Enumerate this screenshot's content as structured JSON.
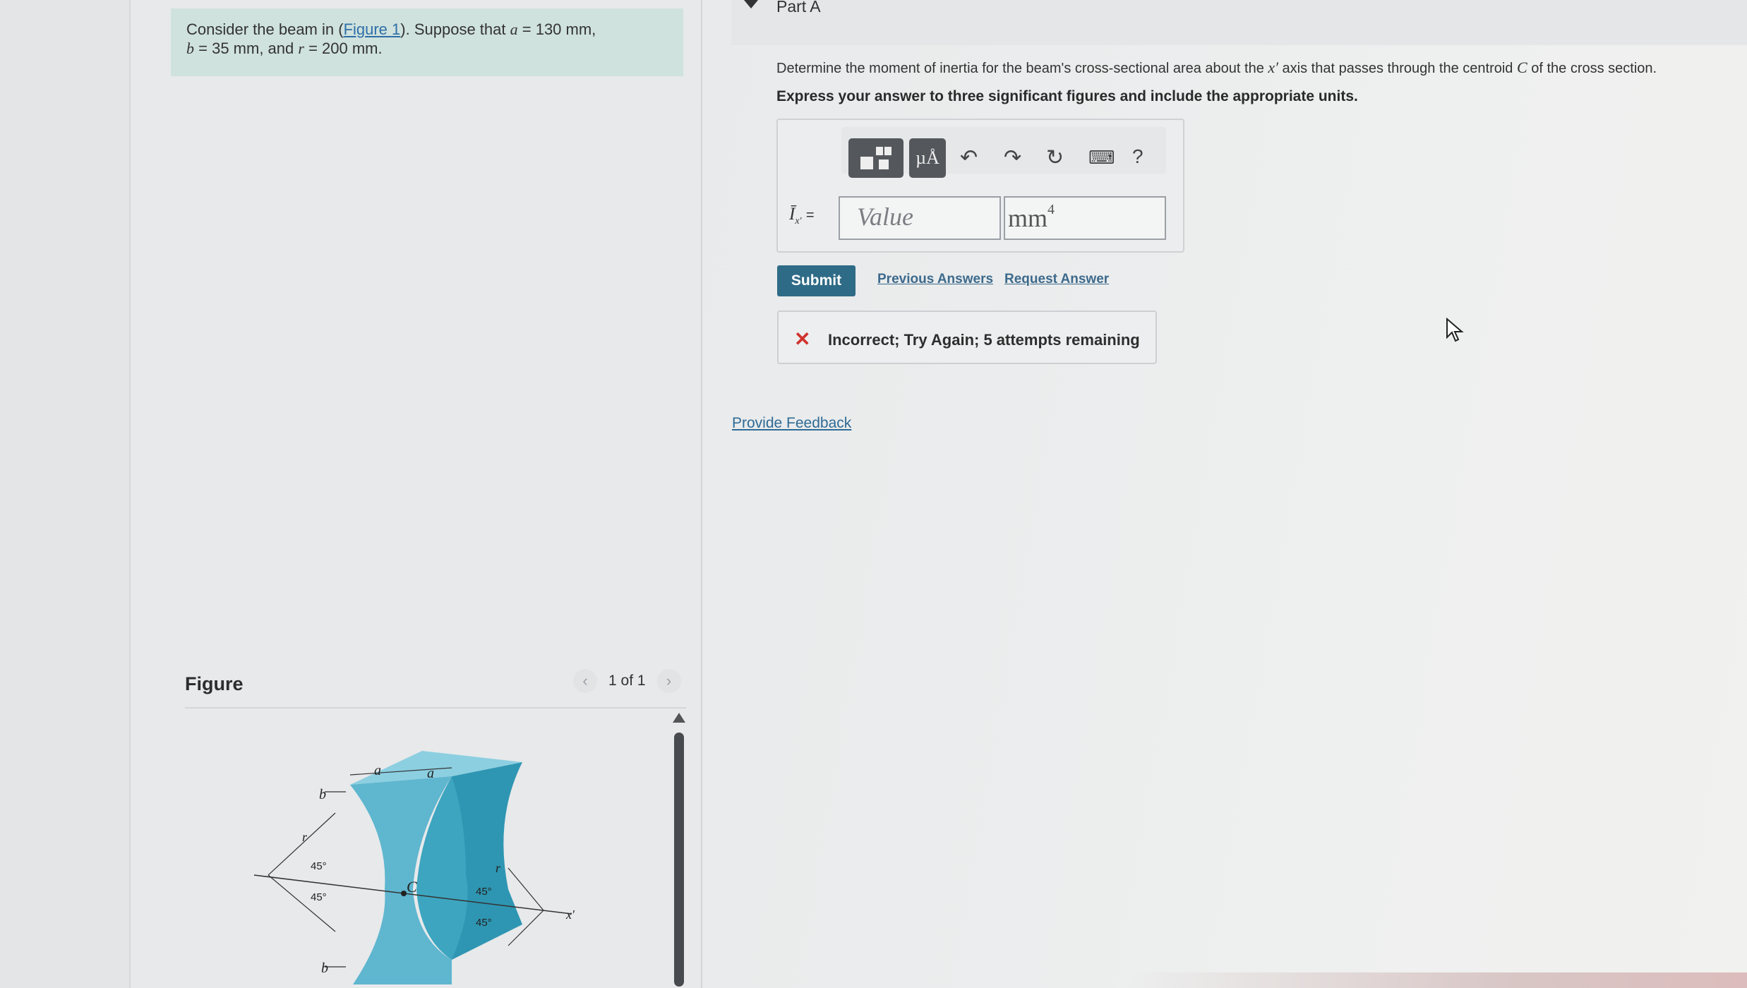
{
  "problem": {
    "prefix": "Consider the beam in (",
    "figure_link": "Figure 1",
    "suffix": "). Suppose that",
    "a_var": "a",
    "a_val": "= 130 mm,",
    "b_var": "b",
    "b_val": "= 35 mm, and",
    "r_var": "r",
    "r_val": "= 200 mm."
  },
  "figure": {
    "title": "Figure",
    "pager": "1 of 1",
    "prev_icon": "chevron-left",
    "next_icon": "chevron-right",
    "labels": {
      "a1": "a",
      "a2": "a",
      "b1": "b",
      "b2": "b",
      "r1": "r",
      "r2": "r",
      "c": "C",
      "x": "x′",
      "ang1": "45°",
      "ang2": "45°",
      "ang3": "45°",
      "ang4": "45°"
    },
    "colors": {
      "beam_front": "#5fb6cf",
      "beam_top": "#8ccfe1",
      "beam_side": "#2e96b2"
    }
  },
  "part": {
    "title": "Part A",
    "question_pre": "Determine the moment of inertia for the beam's cross-sectional area about the",
    "question_var": "x′",
    "question_mid": "axis that passes through the centroid",
    "question_c": "C",
    "question_post": "of the cross section.",
    "instruction": "Express your answer to three significant figures and include the appropriate units."
  },
  "answer": {
    "toolbar": [
      "templates-icon",
      "units-icon",
      "undo-icon",
      "redo-icon",
      "reset-icon",
      "keyboard-icon",
      "help-icon"
    ],
    "units_glyph": "µÅ",
    "help_glyph": "?",
    "label": "Ī",
    "label_sub": "x′",
    "label_eq": "=",
    "value_placeholder": "Value",
    "unit_base": "mm",
    "unit_exp": "4"
  },
  "actions": {
    "submit": "Submit",
    "previous": "Previous Answers",
    "request": "Request Answer"
  },
  "feedback": {
    "icon": "✕",
    "text": "Incorrect; Try Again; 5 attempts remaining"
  },
  "provide_feedback": "Provide Feedback",
  "colors": {
    "accent": "#2e6b86",
    "link": "#2e6fa7",
    "problem_bg": "#cfe2dd",
    "error": "#d0312d"
  }
}
